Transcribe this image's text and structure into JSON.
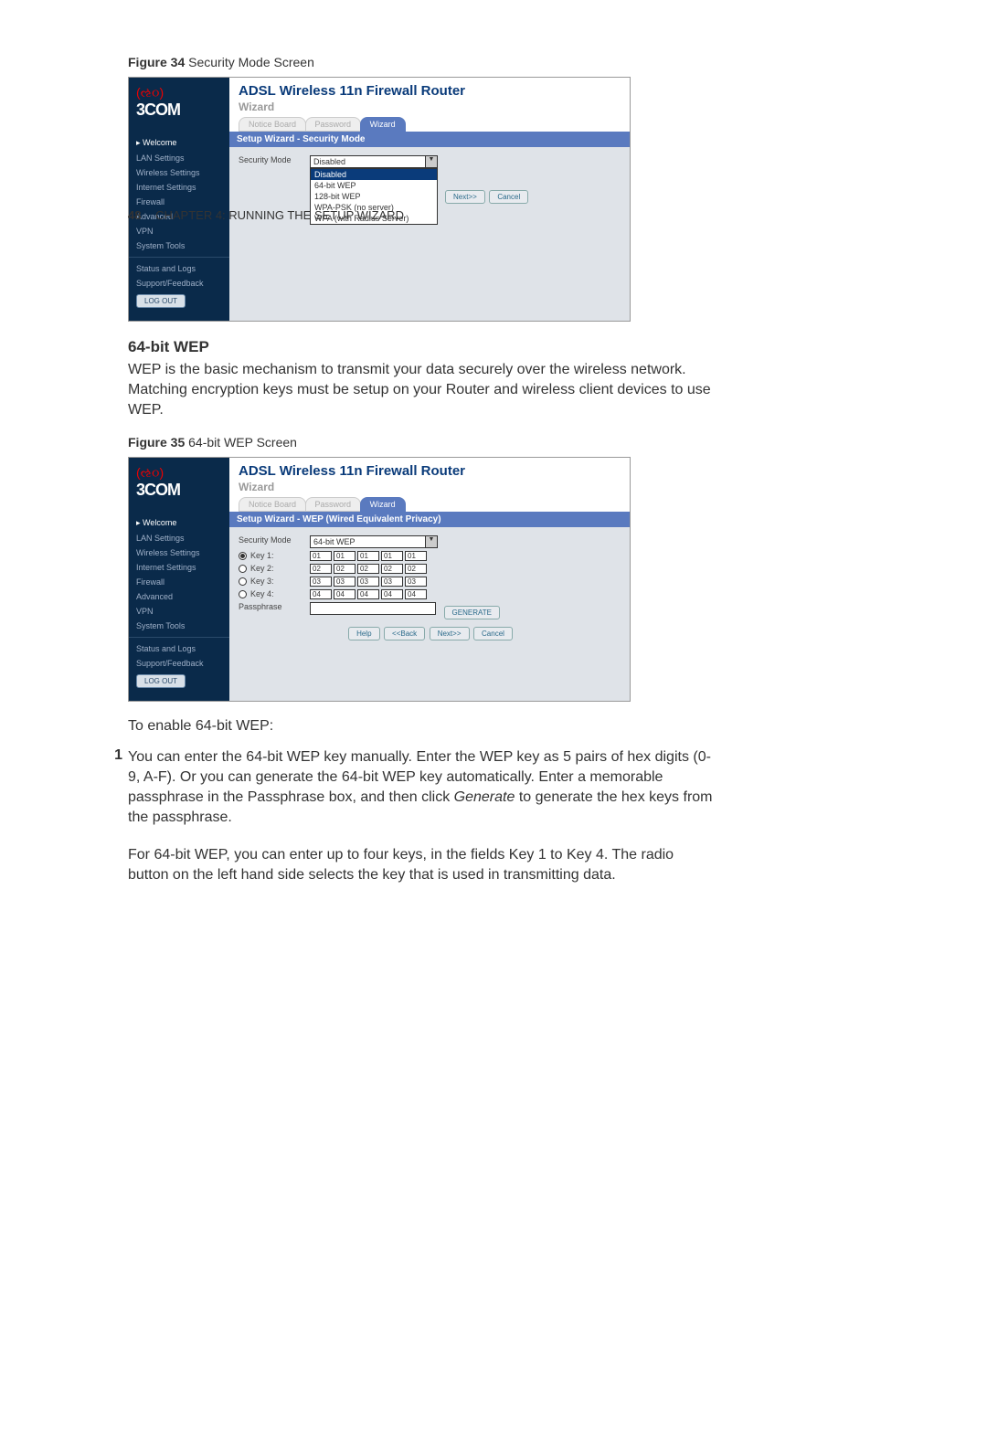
{
  "header": {
    "page_number": "48",
    "chapter_prefix": "C",
    "chapter_text": "HAPTER 4: R",
    "chapter_mid": "UNNING THE ",
    "chapter_s": "S",
    "chapter_end": "ETUP ",
    "chapter_w": "W",
    "chapter_last": "IZARD"
  },
  "fig34": {
    "label_bold": "Figure 34",
    "label_rest": "   Security Mode Screen"
  },
  "shot1": {
    "title": "ADSL Wireless 11n Firewall Router",
    "sub": "Wizard",
    "tabs": {
      "t1": "Notice Board",
      "t2": "Password",
      "t3": "Wizard"
    },
    "sidebar": {
      "welcome": "Welcome",
      "lan": "LAN Settings",
      "wireless": "Wireless Settings",
      "internet": "Internet Settings",
      "firewall": "Firewall",
      "advanced": "Advanced",
      "vpn": "VPN",
      "systools": "System Tools",
      "status": "Status and Logs",
      "support": "Support/Feedback",
      "logout": "LOG OUT"
    },
    "banner": "Setup Wizard - Security Mode",
    "form_label": "Security Mode",
    "dropdown_value": "Disabled",
    "options": {
      "o1": "Disabled",
      "o2": "64-bit WEP",
      "o3": "128-bit WEP",
      "o4": "WPA-PSK (no server)",
      "o5": "WPA (with Radius Server)"
    },
    "next": "Next>>",
    "cancel": "Cancel"
  },
  "section": {
    "head": "64-bit WEP",
    "body": "WEP is the basic mechanism to transmit your data securely over the wireless network. Matching encryption keys must be setup on your Router and wireless client devices to use WEP."
  },
  "fig35": {
    "label_bold": "Figure 35",
    "label_rest": "   64-bit WEP Screen"
  },
  "shot2": {
    "title": "ADSL Wireless 11n Firewall Router",
    "sub": "Wizard",
    "banner": "Setup Wizard - WEP (Wired Equivalent Privacy)",
    "form_label": "Security Mode",
    "dropdown_value": "64-bit WEP",
    "key1label": "Key 1:",
    "key2label": "Key 2:",
    "key3label": "Key 3:",
    "key4label": "Key 4:",
    "passlabel": "Passphrase",
    "k1": "01",
    "k2": "02",
    "k3": "03",
    "k4": "04",
    "generate": "GENERATE",
    "help": "Help",
    "back": "<<Back",
    "next": "Next>>",
    "cancel": "Cancel"
  },
  "enable_line": "To enable 64-bit WEP:",
  "para1": {
    "num": "1",
    "t1": "You can enter the 64-bit WEP key manually. Enter the WEP key as 5 pairs of hex digits (0-9, A-F). Or you can generate the 64-bit WEP key automatically. Enter a memorable passphrase in the Passphrase box, and then click ",
    "ital": "Generate",
    "t2": " to generate the hex keys from the passphrase."
  },
  "para2": "For 64-bit WEP, you can enter up to four keys, in the fields Key 1 to Key 4. The radio button on the left hand side selects the key that is used in transmitting data."
}
